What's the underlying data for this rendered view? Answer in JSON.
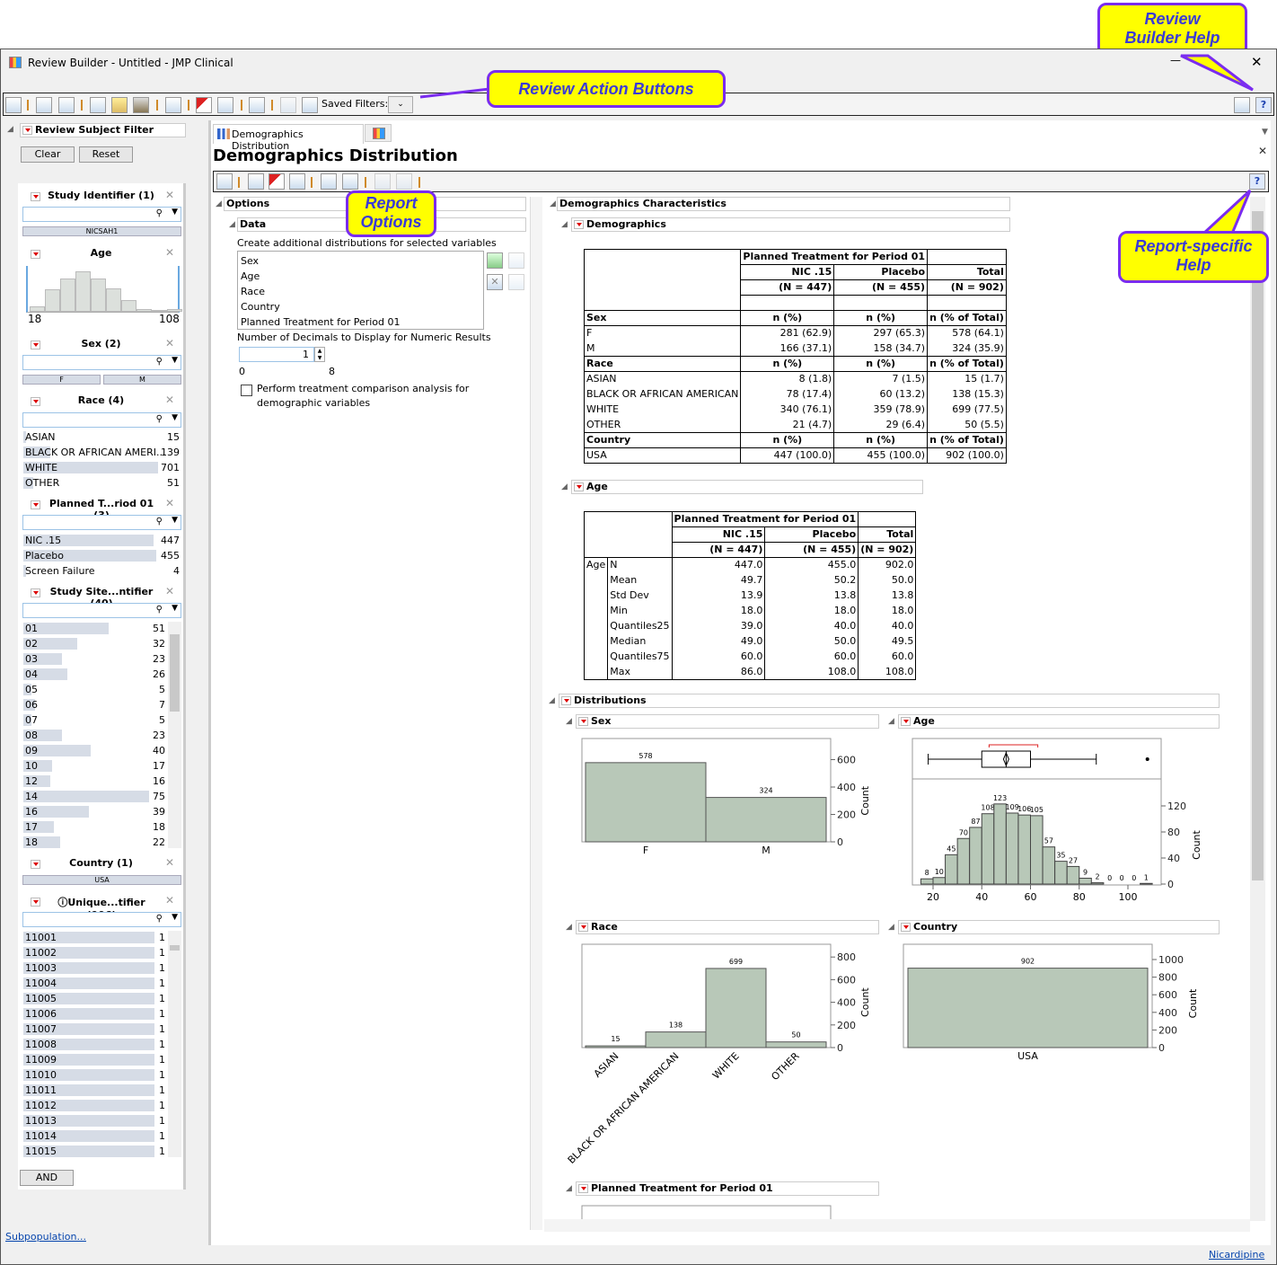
{
  "window": {
    "title": "Review Builder - Untitled - JMP Clinical",
    "minimize": "—",
    "close": "✕"
  },
  "callouts": {
    "help": "Review Builder Help",
    "actions": "Review Action Buttons",
    "report_options": "Report Options",
    "report_help": "Report-specific Help"
  },
  "toolbar": {
    "saved_filters_label": "Saved Filters:",
    "saved_filters_value": ""
  },
  "filter": {
    "title": "Review Subject Filter",
    "clear": "Clear",
    "reset": "Reset",
    "and": "AND",
    "subpop": "Subpopulation...",
    "study": {
      "title": "Study Identifier (1)",
      "chips": [
        "NICSAH1"
      ]
    },
    "age": {
      "title": "Age",
      "min": "18",
      "max": "108",
      "hist": [
        0.12,
        0.48,
        0.72,
        0.86,
        0.72,
        0.5,
        0.25,
        0.05,
        0,
        0.05
      ]
    },
    "sex": {
      "title": "Sex (2)",
      "chips": [
        "F",
        "M"
      ]
    },
    "race": {
      "title": "Race (4)",
      "items": [
        {
          "l": "ASIAN",
          "n": "15"
        },
        {
          "l": "BLACK OR AFRICAN AMERI...",
          "n": "139"
        },
        {
          "l": "WHITE",
          "n": "701"
        },
        {
          "l": "OTHER",
          "n": "51"
        }
      ]
    },
    "trt": {
      "title": "Planned T...riod 01 (3)",
      "items": [
        {
          "l": "NIC .15",
          "n": "447"
        },
        {
          "l": "Placebo",
          "n": "455"
        },
        {
          "l": "Screen Failure",
          "n": "4"
        }
      ]
    },
    "site": {
      "title": "Study Site...ntifier (40)",
      "items": [
        {
          "l": "01",
          "n": "51"
        },
        {
          "l": "02",
          "n": "32"
        },
        {
          "l": "03",
          "n": "23"
        },
        {
          "l": "04",
          "n": "26"
        },
        {
          "l": "05",
          "n": "5"
        },
        {
          "l": "06",
          "n": "7"
        },
        {
          "l": "07",
          "n": "5"
        },
        {
          "l": "08",
          "n": "23"
        },
        {
          "l": "09",
          "n": "40"
        },
        {
          "l": "10",
          "n": "17"
        },
        {
          "l": "12",
          "n": "16"
        },
        {
          "l": "14",
          "n": "75"
        },
        {
          "l": "16",
          "n": "39"
        },
        {
          "l": "17",
          "n": "18"
        },
        {
          "l": "18",
          "n": "22"
        }
      ]
    },
    "country": {
      "title": "Country (1)",
      "chips": [
        "USA"
      ]
    },
    "unique": {
      "title": "Unique...tifier (906)",
      "items": [
        {
          "l": "11001",
          "n": "1"
        },
        {
          "l": "11002",
          "n": "1"
        },
        {
          "l": "11003",
          "n": "1"
        },
        {
          "l": "11004",
          "n": "1"
        },
        {
          "l": "11005",
          "n": "1"
        },
        {
          "l": "11006",
          "n": "1"
        },
        {
          "l": "11007",
          "n": "1"
        },
        {
          "l": "11008",
          "n": "1"
        },
        {
          "l": "11009",
          "n": "1"
        },
        {
          "l": "11010",
          "n": "1"
        },
        {
          "l": "11011",
          "n": "1"
        },
        {
          "l": "11012",
          "n": "1"
        },
        {
          "l": "11013",
          "n": "1"
        },
        {
          "l": "11014",
          "n": "1"
        },
        {
          "l": "11015",
          "n": "1"
        }
      ]
    }
  },
  "tabs": [
    {
      "label": "Demographics Distribution"
    }
  ],
  "report": {
    "title": "Demographics Distribution",
    "footer_link": "Nicardipine"
  },
  "options": {
    "title": "Options",
    "data": "Data",
    "create_label": "Create additional distributions for selected variables",
    "variables": [
      "Sex",
      "Age",
      "Race",
      "Country",
      "Planned Treatment for Period 01"
    ],
    "decimals_label": "Number of Decimals to Display for Numeric Results",
    "decimals_value": "1",
    "slider_min": "0",
    "slider_max": "8",
    "compare_label": "Perform treatment comparison analysis for demographic variables",
    "compare_checked": false
  },
  "sections": {
    "characteristics": "Demographics Characteristics",
    "demographics": "Demographics",
    "age": "Age",
    "distributions": "Distributions",
    "sex": "Sex",
    "age_dist": "Age",
    "race": "Race",
    "country": "Country",
    "trt": "Planned Treatment for Period 01"
  },
  "demo_table": {
    "group_header": "Planned Treatment for Period 01",
    "columns": [
      "NIC .15",
      "Placebo",
      "Total"
    ],
    "ns": [
      "(N = 447)",
      "(N = 455)",
      "(N = 902)"
    ],
    "blocks": [
      {
        "name": "Sex",
        "heads": [
          "n (%)",
          "n (%)",
          "n (% of Total)"
        ],
        "rows": [
          [
            "F",
            "281 (62.9)",
            "297 (65.3)",
            "578 (64.1)"
          ],
          [
            "M",
            "166 (37.1)",
            "158 (34.7)",
            "324 (35.9)"
          ]
        ]
      },
      {
        "name": "Race",
        "heads": [
          "n (%)",
          "n (%)",
          "n (% of Total)"
        ],
        "rows": [
          [
            "ASIAN",
            "8 (1.8)",
            "7 (1.5)",
            "15 (1.7)"
          ],
          [
            "BLACK OR AFRICAN AMERICAN",
            "78 (17.4)",
            "60 (13.2)",
            "138 (15.3)"
          ],
          [
            "WHITE",
            "340 (76.1)",
            "359 (78.9)",
            "699 (77.5)"
          ],
          [
            "OTHER",
            "21 (4.7)",
            "29 (6.4)",
            "50 (5.5)"
          ]
        ]
      },
      {
        "name": "Country",
        "heads": [
          "n (%)",
          "n (%)",
          "n (% of Total)"
        ],
        "rows": [
          [
            "USA",
            "447 (100.0)",
            "455 (100.0)",
            "902 (100.0)"
          ]
        ]
      }
    ]
  },
  "age_table": {
    "group_header": "Planned Treatment for Period 01",
    "columns": [
      "NIC .15",
      "Placebo",
      "Total"
    ],
    "ns": [
      "(N = 447)",
      "(N = 455)",
      "(N = 902)"
    ],
    "var": "Age",
    "rows": [
      [
        "N",
        "447.0",
        "455.0",
        "902.0"
      ],
      [
        "Mean",
        "49.7",
        "50.2",
        "50.0"
      ],
      [
        "Std Dev",
        "13.9",
        "13.8",
        "13.8"
      ],
      [
        "Min",
        "18.0",
        "18.0",
        "18.0"
      ],
      [
        "Quantiles25",
        "39.0",
        "40.0",
        "40.0"
      ],
      [
        "Median",
        "49.0",
        "50.0",
        "49.5"
      ],
      [
        "Quantiles75",
        "60.0",
        "60.0",
        "60.0"
      ],
      [
        "Max",
        "86.0",
        "108.0",
        "108.0"
      ]
    ]
  },
  "chart_data": [
    {
      "id": "sex",
      "type": "bar",
      "categories": [
        "F",
        "M"
      ],
      "values": [
        578,
        324
      ],
      "ylabel": "Count",
      "yticks": [
        0,
        200,
        400,
        600
      ],
      "bar_color": "#b8c8b8"
    },
    {
      "id": "age",
      "type": "bar",
      "xlabel": "",
      "ylabel": "Count",
      "bin_start": 15,
      "bin_width": 5,
      "values": [
        8,
        10,
        45,
        70,
        87,
        108,
        123,
        109,
        106,
        105,
        57,
        35,
        27,
        9,
        2,
        0,
        0,
        0,
        1
      ],
      "xticks": [
        20,
        40,
        60,
        80,
        100
      ],
      "yticks": [
        0,
        40,
        80,
        120
      ],
      "boxplot": {
        "whisker_low": 18,
        "q1": 40,
        "median": 50,
        "q3": 60,
        "whisker_high": 87,
        "mean": 50,
        "outliers": [
          108
        ],
        "shortest_half": [
          43,
          63
        ]
      },
      "bar_color": "#b8c8b8"
    },
    {
      "id": "race",
      "type": "bar",
      "categories": [
        "ASIAN",
        "BLACK OR AFRICAN AMERICAN",
        "WHITE",
        "OTHER"
      ],
      "values": [
        15,
        138,
        699,
        50
      ],
      "ylabel": "Count",
      "yticks": [
        0,
        200,
        400,
        600,
        800
      ],
      "bar_color": "#b8c8b8"
    },
    {
      "id": "country",
      "type": "bar",
      "categories": [
        "USA"
      ],
      "values": [
        902
      ],
      "ylabel": "Count",
      "yticks": [
        0,
        200,
        400,
        600,
        800,
        1000
      ],
      "bar_color": "#b8c8b8"
    }
  ]
}
